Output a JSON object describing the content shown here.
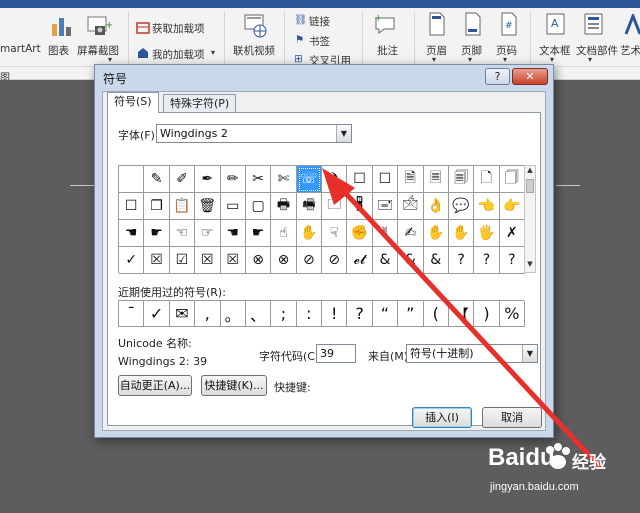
{
  "ribbon": {
    "items": [
      {
        "label": "martArt"
      },
      {
        "label": "图表"
      },
      {
        "label": "屏幕截图"
      },
      {
        "label": "获取加载项"
      },
      {
        "label": "我的加载项"
      },
      {
        "label": "联机视频"
      },
      {
        "label": "链接"
      },
      {
        "label": "书签"
      },
      {
        "label": "交叉引用"
      },
      {
        "label": "批注"
      },
      {
        "label": "页眉"
      },
      {
        "label": "页脚"
      },
      {
        "label": "页码"
      },
      {
        "label": "文本框"
      },
      {
        "label": "文档部件"
      },
      {
        "label": "艺术"
      }
    ],
    "group_label": "图"
  },
  "dialog": {
    "title": "符号",
    "help_button": "?",
    "close_button": "✕",
    "tabs": [
      {
        "label": "符号(S)"
      },
      {
        "label": "特殊字符(P)"
      }
    ],
    "font_label": "字体(F):",
    "font_value": "Wingdings 2",
    "symbol_rows": [
      [
        "",
        "✎",
        "✐",
        "✒",
        "✏",
        "✂",
        "✄",
        "☏",
        "❩",
        "☐",
        "☐",
        "🗎",
        "🗏",
        "🗐",
        "🗋",
        "🗍"
      ],
      [
        "☐",
        "❐",
        "📋",
        "🗑",
        "▭",
        "▢",
        "🖶",
        "🖷",
        "🗀",
        "🖁",
        "🖃",
        "🖄",
        "👌",
        "💬",
        "👈",
        "👉"
      ],
      [
        "☚",
        "☛",
        "☜",
        "☞",
        "☚",
        "☛",
        "☝",
        "✋",
        "☟",
        "✊",
        "✌",
        "✍",
        "✋",
        "✋",
        "🖐",
        "✗"
      ],
      [
        "✓",
        "☒",
        "☑",
        "☒",
        "☒",
        "⊗",
        "⊗",
        "⊘",
        "⊘",
        "𝓮𝓽",
        "&",
        "&",
        "&",
        "?",
        "?",
        "?"
      ]
    ],
    "selected_index": [
      0,
      7
    ],
    "recent_label": "近期使用过的符号(R):",
    "recent_symbols": [
      "¯",
      "✓",
      "✉",
      ",",
      "。",
      "、",
      ";",
      ":",
      "!",
      "?",
      "“",
      "”",
      "(",
      "【",
      ")",
      "%"
    ],
    "unicode_name_label": "Unicode 名称:",
    "unicode_name_value": "Wingdings 2: 39",
    "char_code_label": "字符代码(C):",
    "char_code_value": "39",
    "from_label": "来自(M):",
    "from_value": "符号(十进制)",
    "autocorrect_button": "自动更正(A)...",
    "shortcut_key_button": "快捷键(K)...",
    "shortcut_key_label": "快捷键:",
    "insert_button": "插入(I)",
    "cancel_button": "取消"
  },
  "watermark": {
    "logo": "Baidu",
    "jingyan": "经验",
    "url": "jingyan.baidu.com"
  },
  "colors": {
    "selection": "#3399ff",
    "arrow": "#e8302a",
    "ribbon_accent": "#2b579a"
  }
}
